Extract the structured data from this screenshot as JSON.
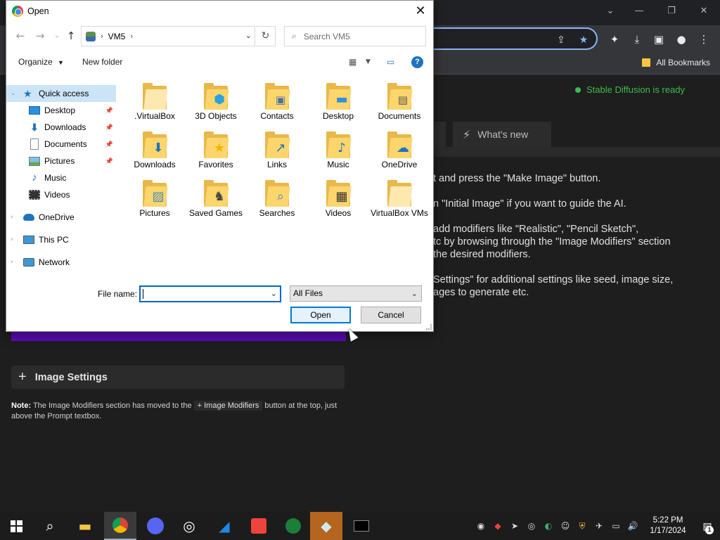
{
  "browser": {
    "bookmarks_label": "All Bookmarks"
  },
  "page": {
    "status_text": "Stable Diffusion is ready",
    "tab_whatsnew": "What's new",
    "help_lines": [
      "t and press the \"Make Image\" button.",
      "n \"Initial Image\" if you want to guide the AI.",
      "add modifiers like \"Realistic\", \"Pencil Sketch\",",
      "tc by browsing through the \"Image Modifiers\" section",
      " the desired modifiers.",
      "Settings\" for additional settings like seed, image size,",
      "ages to generate etc."
    ],
    "image_settings_label": "Image Settings",
    "note_label": "Note:",
    "note_text_1": " The Image Modifiers section has moved to the ",
    "note_code": "+ Image Modifiers",
    "note_text_2": " button at the top, just above the Prompt textbox."
  },
  "dialog": {
    "title": "Open",
    "address_path": "VM5",
    "search_placeholder": "Search VM5",
    "organize_label": "Organize",
    "new_folder_label": "New folder",
    "help_label": "?",
    "nav_items": [
      {
        "label": "Quick access",
        "icon": "star-icon",
        "pinned": false
      },
      {
        "label": "Desktop",
        "icon": "desktop-icon",
        "pinned": true
      },
      {
        "label": "Downloads",
        "icon": "download-icon",
        "pinned": true
      },
      {
        "label": "Documents",
        "icon": "document-icon",
        "pinned": true
      },
      {
        "label": "Pictures",
        "icon": "picture-icon",
        "pinned": true
      },
      {
        "label": "Music",
        "icon": "music-icon",
        "pinned": false
      },
      {
        "label": "Videos",
        "icon": "video-icon",
        "pinned": false
      },
      {
        "label": "OneDrive",
        "icon": "cloud-icon",
        "pinned": false
      },
      {
        "label": "This PC",
        "icon": "pc-icon",
        "pinned": false
      },
      {
        "label": "Network",
        "icon": "network-icon",
        "pinned": false
      }
    ],
    "files": [
      {
        "label": ".VirtualBox",
        "overlay": "none"
      },
      {
        "label": "3D Objects",
        "overlay": "cube-icon"
      },
      {
        "label": "Contacts",
        "overlay": "contact-card-icon"
      },
      {
        "label": "Desktop",
        "overlay": "desktop-icon"
      },
      {
        "label": "Documents",
        "overlay": "document-icon"
      },
      {
        "label": "Downloads",
        "overlay": "download-arrow-icon"
      },
      {
        "label": "Favorites",
        "overlay": "star-icon"
      },
      {
        "label": "Links",
        "overlay": "link-arrow-icon"
      },
      {
        "label": "Music",
        "overlay": "music-note-icon"
      },
      {
        "label": "OneDrive",
        "overlay": "cloud-icon"
      },
      {
        "label": "Pictures",
        "overlay": "picture-icon"
      },
      {
        "label": "Saved Games",
        "overlay": "chess-piece-icon"
      },
      {
        "label": "Searches",
        "overlay": "magnifier-icon"
      },
      {
        "label": "Videos",
        "overlay": "film-icon"
      },
      {
        "label": "VirtualBox VMs",
        "overlay": "none"
      }
    ],
    "filename_label": "File name:",
    "filename_value": "",
    "filetype_value": "All Files",
    "open_label": "Open",
    "cancel_label": "Cancel"
  },
  "taskbar": {
    "time": "5:22 PM",
    "date": "1/17/2024",
    "notification_count": "1"
  }
}
